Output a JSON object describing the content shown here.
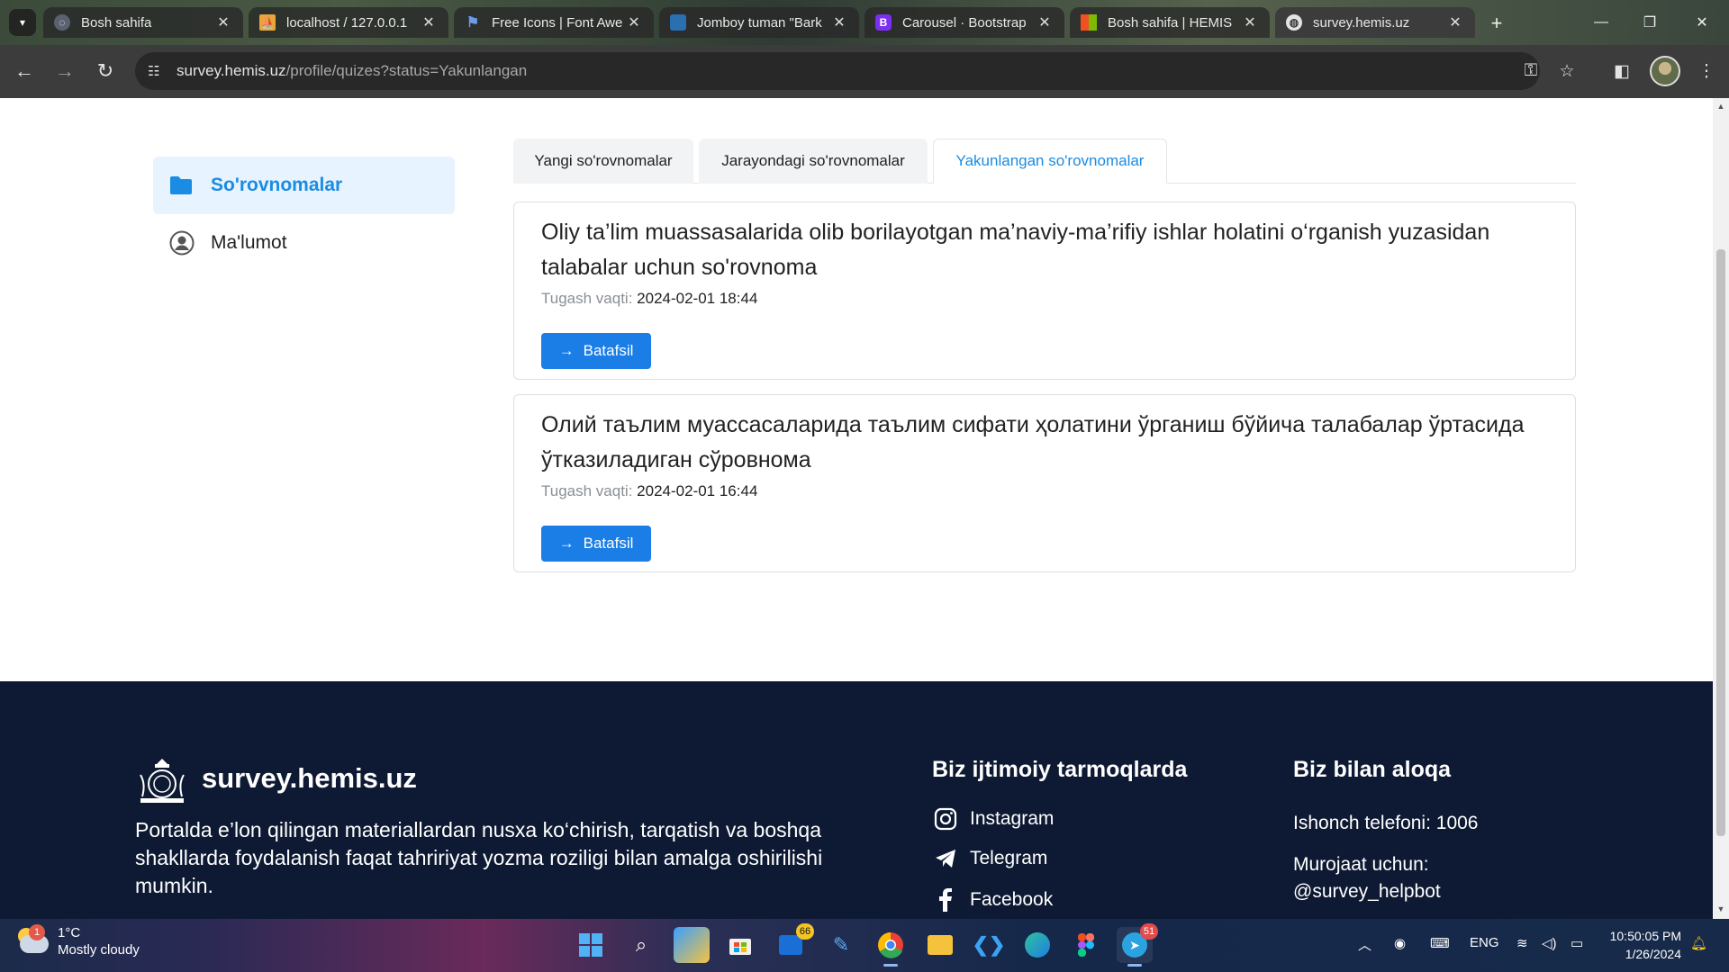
{
  "browser": {
    "tabs": [
      {
        "title": "Bosh sahifa",
        "icon": "chrome-icon"
      },
      {
        "title": "localhost / 127.0.0.1",
        "icon": "phpmyadmin-icon"
      },
      {
        "title": "Free Icons | Font Awe",
        "icon": "flag-icon"
      },
      {
        "title": "Jomboy tuman \"Bark",
        "icon": "site-icon"
      },
      {
        "title": "Carousel · Bootstrap",
        "icon": "bootstrap-icon"
      },
      {
        "title": "Bosh sahifa | HEMIS",
        "icon": "microsoft-icon"
      },
      {
        "title": "survey.hemis.uz",
        "icon": "globe-icon"
      }
    ],
    "active_tab": 6,
    "new_tab": "+",
    "url_host": "survey.hemis.uz",
    "url_path": "/profile/quizes?status=Yakunlangan"
  },
  "sidebar": {
    "items": [
      {
        "label": "So'rovnomalar",
        "icon": "folder-icon",
        "active": true
      },
      {
        "label": "Ma'lumot",
        "icon": "user-circle-icon",
        "active": false
      }
    ]
  },
  "quiz_tabs": [
    {
      "label": "Yangi so'rovnomalar"
    },
    {
      "label": "Jarayondagi so'rovnomalar"
    },
    {
      "label": "Yakunlangan so'rovnomalar",
      "active": true
    }
  ],
  "quizzes": [
    {
      "title": "Oliy ta’lim muassasalarida olib borilayotgan ma’naviy-ma’rifiy ishlar holatini o‘rganish yuzasidan talabalar uchun so'rovnoma",
      "deadline_label": "Tugash vaqti:",
      "deadline": "2024-02-01 18:44",
      "button": "Batafsil"
    },
    {
      "title": "Олий таълим муассасаларида таълим сифати ҳолатини ўрганиш бўйича талабалар ўртасида ўтказиладиган сўровнома",
      "deadline_label": "Tugash vaqti:",
      "deadline": "2024-02-01 16:44",
      "button": "Batafsil"
    }
  ],
  "footer": {
    "brand": "survey.hemis.uz",
    "about": "Portalda e’lon qilingan materiallardan nusxa ko‘chirish, tarqatish va boshqa shakllarda foydalanish faqat tahririyat yozma roziligi bilan amalga oshirilishi mumkin.",
    "social_heading": "Biz ijtimoiy tarmoqlarda",
    "social": [
      {
        "label": "Instagram",
        "icon": "instagram-icon"
      },
      {
        "label": "Telegram",
        "icon": "telegram-icon"
      },
      {
        "label": "Facebook",
        "icon": "facebook-icon"
      }
    ],
    "contact_heading": "Biz bilan aloqa",
    "hotline": "Ishonch telefoni: 1006",
    "appeal_label": "Murojaat uchun:",
    "appeal_handle": "@survey_helpbot"
  },
  "taskbar": {
    "weather_temp": "1°C",
    "weather_desc": "Mostly cloudy",
    "weather_badge": "1",
    "store_badge": "66",
    "telegram_badge": "51",
    "language": "ENG",
    "time": "10:50:05 PM",
    "date": "1/26/2024"
  },
  "colors": {
    "accent": "#1a7ee6",
    "footer_bg": "#0e1a33",
    "sidebar_active_bg": "#e7f3fe"
  }
}
